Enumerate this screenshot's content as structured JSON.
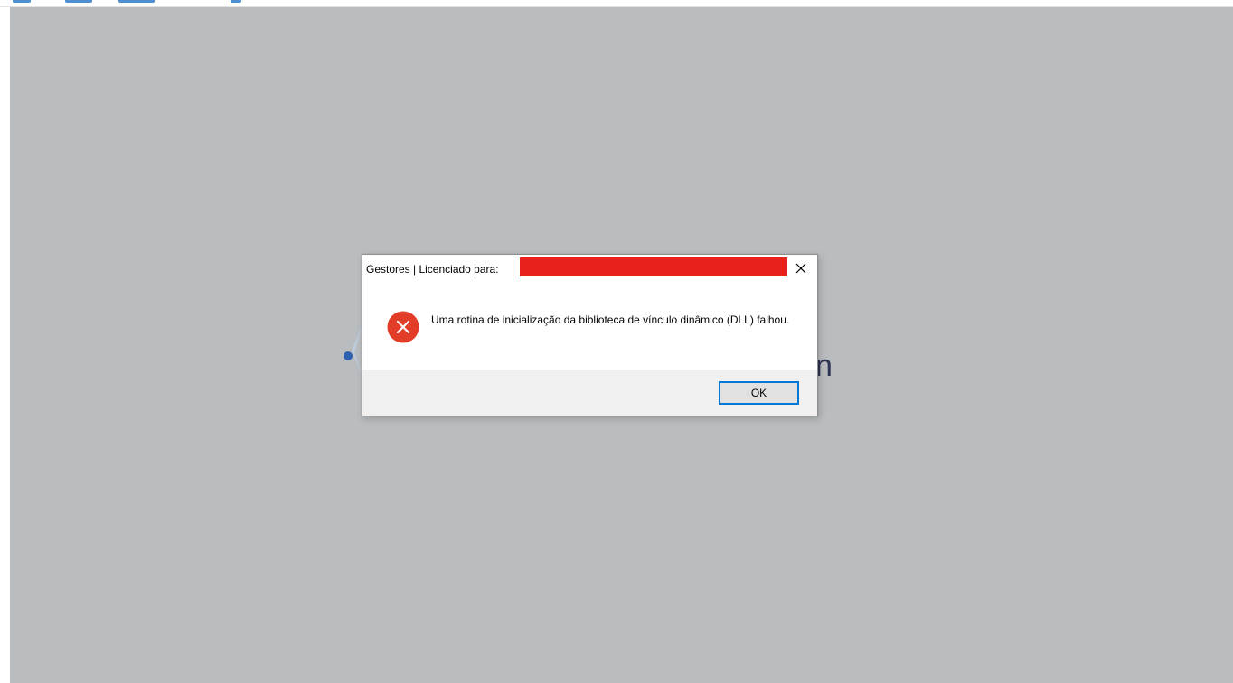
{
  "dialog": {
    "title": "Gestores | Licenciado para:",
    "message": "Uma rotina de inicialização da biblioteca de vínculo dinâmico (DLL) falhou.",
    "ok_label": "OK",
    "icon": "error-icon",
    "close_icon": "close-icon"
  },
  "background": {
    "splash_partial_text": "n"
  },
  "colors": {
    "workspace": "#babdbf",
    "redaction": "#e8211d",
    "error_icon": "#e23d28",
    "button_focus": "#0078d7"
  }
}
